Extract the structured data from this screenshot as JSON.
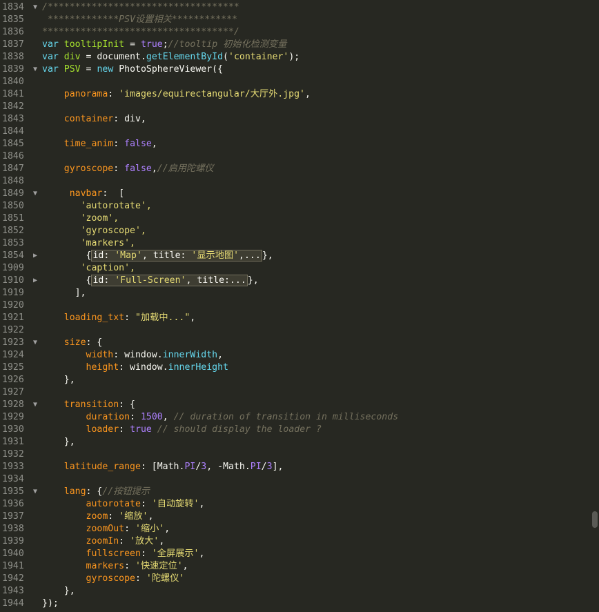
{
  "editor": {
    "lines": [
      {
        "num": "1834",
        "fold": "▼",
        "code": "/***********************************"
      },
      {
        "num": "1835",
        "fold": "",
        "code": " *************PSV设置相关************"
      },
      {
        "num": "1836",
        "fold": "",
        "code": "***********************************/"
      },
      {
        "num": "1837",
        "fold": "",
        "code": "var tooltipInit = true;//tooltip 初始化检测变量"
      },
      {
        "num": "1838",
        "fold": "",
        "code": "var div = document.getElementById('container');"
      },
      {
        "num": "1839",
        "fold": "▼",
        "code": "var PSV = new PhotoSphereViewer({"
      },
      {
        "num": "1840",
        "fold": "",
        "code": ""
      },
      {
        "num": "1841",
        "fold": "",
        "code": "    panorama: 'images/equirectangular/大厅外.jpg',"
      },
      {
        "num": "1842",
        "fold": "",
        "code": ""
      },
      {
        "num": "1843",
        "fold": "",
        "code": "    container: div,"
      },
      {
        "num": "1844",
        "fold": "",
        "code": ""
      },
      {
        "num": "1845",
        "fold": "",
        "code": "    time_anim: false,"
      },
      {
        "num": "1846",
        "fold": "",
        "code": ""
      },
      {
        "num": "1847",
        "fold": "",
        "code": "    gyroscope: false,//启用陀螺仪"
      },
      {
        "num": "1848",
        "fold": "",
        "code": ""
      },
      {
        "num": "1849",
        "fold": "▼",
        "code": "     navbar:  ["
      },
      {
        "num": "1850",
        "fold": "",
        "code": "       'autorotate',"
      },
      {
        "num": "1851",
        "fold": "",
        "code": "       'zoom',"
      },
      {
        "num": "1852",
        "fold": "",
        "code": "       'gyroscope',"
      },
      {
        "num": "1853",
        "fold": "",
        "code": "       'markers',"
      },
      {
        "num": "1854",
        "fold": "▶",
        "code": "        {id: 'Map', title: '显示地图',...},"
      },
      {
        "num": "1909",
        "fold": "",
        "code": "       'caption',"
      },
      {
        "num": "1910",
        "fold": "▶",
        "code": "        {id: 'Full-Screen', title:...},"
      },
      {
        "num": "1919",
        "fold": "",
        "code": "      ],"
      },
      {
        "num": "1920",
        "fold": "",
        "code": ""
      },
      {
        "num": "1921",
        "fold": "",
        "code": "    loading_txt: \"加载中...\","
      },
      {
        "num": "1922",
        "fold": "",
        "code": ""
      },
      {
        "num": "1923",
        "fold": "▼",
        "code": "    size: {"
      },
      {
        "num": "1924",
        "fold": "",
        "code": "        width: window.innerWidth,"
      },
      {
        "num": "1925",
        "fold": "",
        "code": "        height: window.innerHeight"
      },
      {
        "num": "1926",
        "fold": "",
        "code": "    },"
      },
      {
        "num": "1927",
        "fold": "",
        "code": ""
      },
      {
        "num": "1928",
        "fold": "▼",
        "code": "    transition: {"
      },
      {
        "num": "1929",
        "fold": "",
        "code": "        duration: 1500, // duration of transition in milliseconds"
      },
      {
        "num": "1930",
        "fold": "",
        "code": "        loader: true // should display the loader ?"
      },
      {
        "num": "1931",
        "fold": "",
        "code": "    },"
      },
      {
        "num": "1932",
        "fold": "",
        "code": ""
      },
      {
        "num": "1933",
        "fold": "",
        "code": "    latitude_range: [Math.PI/3, -Math.PI/3],"
      },
      {
        "num": "1934",
        "fold": "",
        "code": ""
      },
      {
        "num": "1935",
        "fold": "▼",
        "code": "    lang: {//按钮提示"
      },
      {
        "num": "1936",
        "fold": "",
        "code": "        autorotate: '自动旋转',"
      },
      {
        "num": "1937",
        "fold": "",
        "code": "        zoom: '缩放',"
      },
      {
        "num": "1938",
        "fold": "",
        "code": "        zoomOut: '缩小',"
      },
      {
        "num": "1939",
        "fold": "",
        "code": "        zoomIn: '放大',"
      },
      {
        "num": "1940",
        "fold": "",
        "code": "        fullscreen: '全屏展示',"
      },
      {
        "num": "1941",
        "fold": "",
        "code": "        markers: '快速定位',"
      },
      {
        "num": "1942",
        "fold": "",
        "code": "        gyroscope: '陀螺仪'"
      },
      {
        "num": "1943",
        "fold": "",
        "code": "    },"
      },
      {
        "num": "1944",
        "fold": "",
        "code": "});"
      }
    ]
  },
  "colors": {
    "background": "#272822",
    "line_number": "#8f908a",
    "keyword": "#66d9ef",
    "variable": "#a6e22e",
    "property": "#fd971f",
    "string": "#e6db74",
    "number": "#ae81ff",
    "comment": "#75715e",
    "text": "#f8f8f2"
  }
}
